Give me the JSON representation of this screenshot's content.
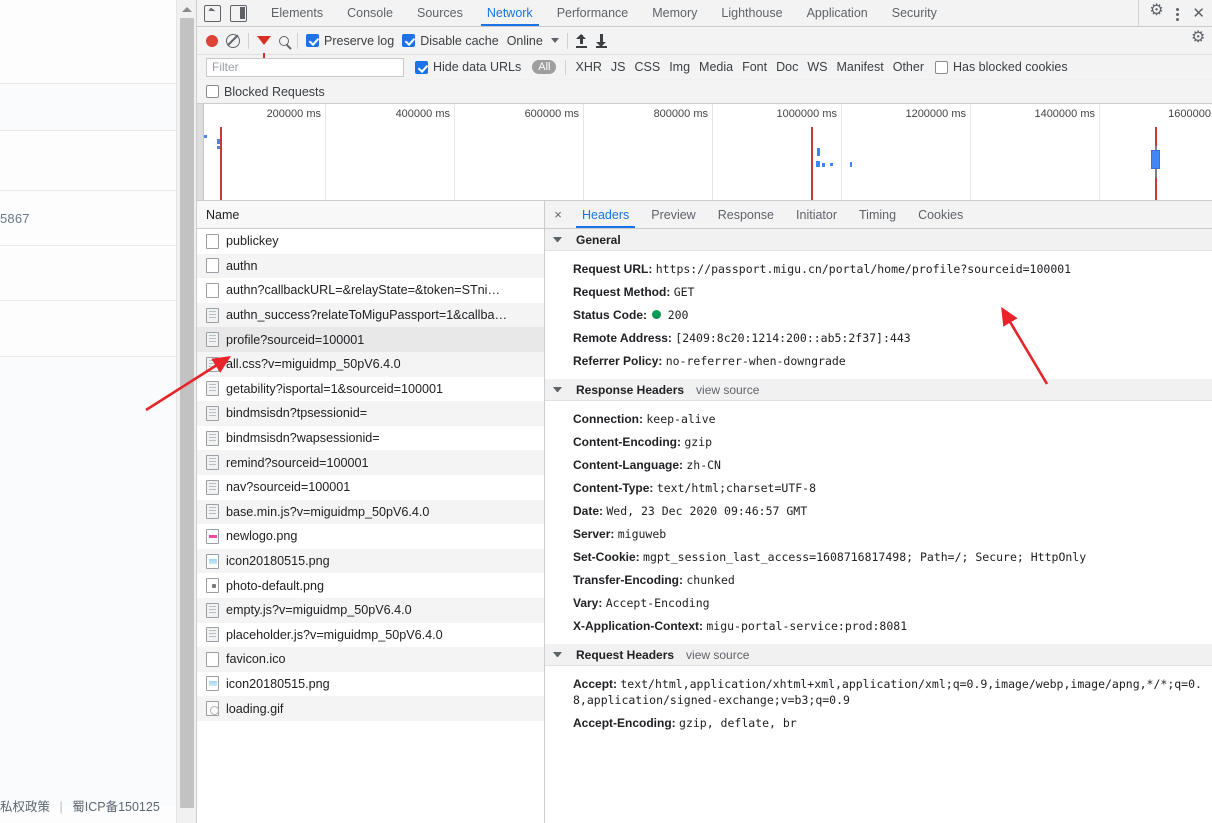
{
  "page_behind": {
    "visible_number": "5867",
    "footer_left": "私权政策",
    "footer_sep": "|",
    "footer_right": "蜀ICP备150125"
  },
  "devtools": {
    "main_tabs": [
      {
        "label": "Elements",
        "active": false
      },
      {
        "label": "Console",
        "active": false
      },
      {
        "label": "Sources",
        "active": false
      },
      {
        "label": "Network",
        "active": true
      },
      {
        "label": "Performance",
        "active": false
      },
      {
        "label": "Memory",
        "active": false
      },
      {
        "label": "Lighthouse",
        "active": false
      },
      {
        "label": "Application",
        "active": false
      },
      {
        "label": "Security",
        "active": false
      }
    ],
    "icons": {
      "inspect": "inspect-element-icon",
      "device": "device-toolbar-icon",
      "settings": "gear-icon",
      "more": "kebab-menu-icon",
      "close": "close-icon"
    },
    "controls": {
      "record_label": "record-button",
      "clear_label": "clear-button",
      "filter_toggle_label": "filter-toggle",
      "search_label": "search-button",
      "preserve_log": "Preserve log",
      "preserve_log_checked": true,
      "disable_cache": "Disable cache",
      "disable_cache_checked": true,
      "throttle": "Online",
      "import_har": "import-har-icon",
      "export_har": "export-har-icon",
      "network_settings": "network-settings-gear-icon"
    },
    "filters": {
      "filter_placeholder": "Filter",
      "filter_value": "",
      "hide_data_urls": "Hide data URLs",
      "hide_data_urls_checked": true,
      "types": [
        "All",
        "XHR",
        "JS",
        "CSS",
        "Img",
        "Media",
        "Font",
        "Doc",
        "WS",
        "Manifest",
        "Other"
      ],
      "active_type": "All",
      "has_blocked_cookies": "Has blocked cookies",
      "has_blocked_cookies_checked": false,
      "blocked_requests": "Blocked Requests",
      "blocked_requests_checked": false
    },
    "overview": {
      "ticks": [
        "200000 ms",
        "400000 ms",
        "600000 ms",
        "800000 ms",
        "1000000 ms",
        "1200000 ms",
        "1400000 ms",
        "1600000"
      ]
    },
    "request_list": {
      "column_header": "Name",
      "rows": [
        {
          "name": "publickey",
          "icon": "plain",
          "selected": false
        },
        {
          "name": "authn",
          "icon": "plain",
          "selected": false
        },
        {
          "name": "authn?callbackURL=&relayState=&token=STni…",
          "icon": "plain",
          "selected": false
        },
        {
          "name": "authn_success?relateToMiguPassport=1&callba…",
          "icon": "doc",
          "selected": false
        },
        {
          "name": "profile?sourceid=100001",
          "icon": "doc",
          "selected": true
        },
        {
          "name": "all.css?v=miguidmp_50pV6.4.0",
          "icon": "doc",
          "selected": false
        },
        {
          "name": "getability?isportal=1&sourceid=100001",
          "icon": "doc",
          "selected": false
        },
        {
          "name": "bindmsisdn?tpsessionid=",
          "icon": "doc",
          "selected": false
        },
        {
          "name": "bindmsisdn?wapsessionid=",
          "icon": "doc",
          "selected": false
        },
        {
          "name": "remind?sourceid=100001",
          "icon": "doc",
          "selected": false
        },
        {
          "name": "nav?sourceid=100001",
          "icon": "doc",
          "selected": false
        },
        {
          "name": "base.min.js?v=miguidmp_50pV6.4.0",
          "icon": "doc",
          "selected": false
        },
        {
          "name": "newlogo.png",
          "icon": "img-pink",
          "selected": false
        },
        {
          "name": "icon20180515.png",
          "icon": "img-blue",
          "selected": false
        },
        {
          "name": "photo-default.png",
          "icon": "img-dot",
          "selected": false
        },
        {
          "name": "empty.js?v=miguidmp_50pV6.4.0",
          "icon": "doc",
          "selected": false
        },
        {
          "name": "placeholder.js?v=miguidmp_50pV6.4.0",
          "icon": "doc",
          "selected": false
        },
        {
          "name": "favicon.ico",
          "icon": "plain",
          "selected": false
        },
        {
          "name": "icon20180515.png",
          "icon": "img-blue",
          "selected": false
        },
        {
          "name": "loading.gif",
          "icon": "img-gif",
          "selected": false
        }
      ]
    },
    "details": {
      "close_label": "×",
      "tabs": [
        {
          "label": "Headers",
          "active": true
        },
        {
          "label": "Preview",
          "active": false
        },
        {
          "label": "Response",
          "active": false
        },
        {
          "label": "Initiator",
          "active": false
        },
        {
          "label": "Timing",
          "active": false
        },
        {
          "label": "Cookies",
          "active": false
        }
      ],
      "sections": [
        {
          "title": "General",
          "view_source": "",
          "rows": [
            {
              "key": "Request URL:",
              "value": "https://passport.migu.cn/portal/home/profile?sourceid=100001",
              "status": false
            },
            {
              "key": "Request Method:",
              "value": "GET",
              "status": false
            },
            {
              "key": "Status Code:",
              "value": "200",
              "status": true
            },
            {
              "key": "Remote Address:",
              "value": "[2409:8c20:1214:200::ab5:2f37]:443",
              "status": false
            },
            {
              "key": "Referrer Policy:",
              "value": "no-referrer-when-downgrade",
              "status": false
            }
          ]
        },
        {
          "title": "Response Headers",
          "view_source": "view source",
          "rows": [
            {
              "key": "Connection:",
              "value": "keep-alive",
              "status": false
            },
            {
              "key": "Content-Encoding:",
              "value": "gzip",
              "status": false
            },
            {
              "key": "Content-Language:",
              "value": "zh-CN",
              "status": false
            },
            {
              "key": "Content-Type:",
              "value": "text/html;charset=UTF-8",
              "status": false
            },
            {
              "key": "Date:",
              "value": "Wed, 23 Dec 2020 09:46:57 GMT",
              "status": false
            },
            {
              "key": "Server:",
              "value": "miguweb",
              "status": false
            },
            {
              "key": "Set-Cookie:",
              "value": "mgpt_session_last_access=1608716817498; Path=/; Secure; HttpOnly",
              "status": false
            },
            {
              "key": "Transfer-Encoding:",
              "value": "chunked",
              "status": false
            },
            {
              "key": "Vary:",
              "value": "Accept-Encoding",
              "status": false
            },
            {
              "key": "X-Application-Context:",
              "value": "migu-portal-service:prod:8081",
              "status": false
            }
          ]
        },
        {
          "title": "Request Headers",
          "view_source": "view source",
          "rows": [
            {
              "key": "Accept:",
              "value": "text/html,application/xhtml+xml,application/xml;q=0.9,image/webp,image/apng,*/*;q=0.8,application/signed-exchange;v=b3;q=0.9",
              "status": false
            },
            {
              "key": "Accept-Encoding:",
              "value": "gzip, deflate, br",
              "status": false
            }
          ]
        }
      ]
    }
  },
  "colors": {
    "accent": "#1a73e8",
    "record_red": "#db4437",
    "status_green": "#0f9d58",
    "annotation_red": "#e8232a",
    "timeline_blue": "#4285f4",
    "timeline_red": "#c8393a"
  }
}
